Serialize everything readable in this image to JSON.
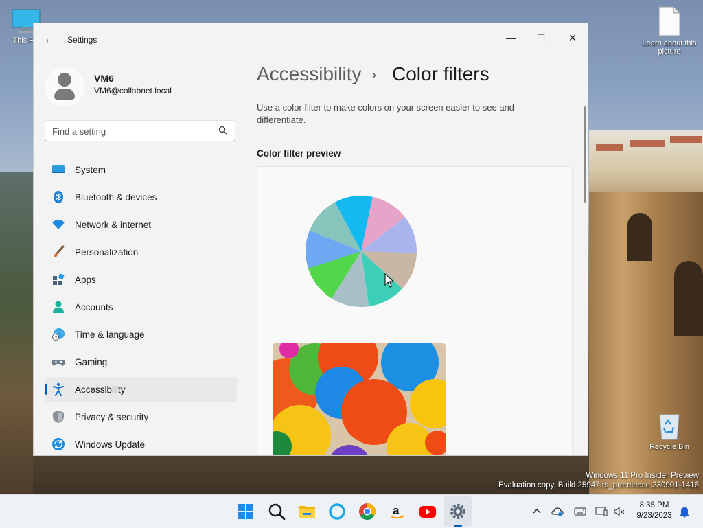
{
  "desktop": {
    "icons": [
      {
        "label": "This PC"
      },
      {
        "label": "Learn about this picture"
      },
      {
        "label": "Recycle Bin"
      }
    ],
    "watermark": {
      "line1": "Windows 11 Pro Insider Preview",
      "line2": "Evaluation copy. Build 25947.rs_prerelease.230901-1416"
    }
  },
  "window": {
    "title": "Settings",
    "controls": {
      "minimize": "—",
      "maximize": "☐",
      "close": "✕"
    }
  },
  "user": {
    "name": "VM6",
    "email": "VM6@collabnet.local"
  },
  "search": {
    "placeholder": "Find a setting"
  },
  "nav": {
    "items": [
      {
        "label": "System",
        "icon": "system-icon"
      },
      {
        "label": "Bluetooth & devices",
        "icon": "bluetooth-icon"
      },
      {
        "label": "Network & internet",
        "icon": "wifi-icon"
      },
      {
        "label": "Personalization",
        "icon": "brush-icon"
      },
      {
        "label": "Apps",
        "icon": "apps-icon"
      },
      {
        "label": "Accounts",
        "icon": "accounts-icon"
      },
      {
        "label": "Time & language",
        "icon": "globe-clock-icon"
      },
      {
        "label": "Gaming",
        "icon": "controller-icon"
      },
      {
        "label": "Accessibility",
        "icon": "accessibility-icon",
        "active": true
      },
      {
        "label": "Privacy & security",
        "icon": "shield-icon"
      },
      {
        "label": "Windows Update",
        "icon": "update-icon"
      }
    ]
  },
  "page": {
    "breadcrumb_parent": "Accessibility",
    "breadcrumb_sep": "›",
    "breadcrumb_current": "Color filters",
    "description": "Use a color filter to make colors on your screen easier to see and differentiate.",
    "section_title": "Color filter preview"
  },
  "preview": {
    "pie_colors": [
      "#e6a4c8",
      "#a9b4ec",
      "#c9b6a4",
      "#3ecfb9",
      "#a8bfc8",
      "#52d74a",
      "#6ea8f3",
      "#87c5bc",
      "#14b9ef"
    ]
  },
  "taskbar": {
    "apps": [
      "windows-start-icon",
      "search-icon",
      "file-explorer-icon",
      "cortana-icon",
      "chrome-icon",
      "amazon-icon",
      "youtube-icon",
      "settings-icon"
    ],
    "clock": {
      "time": "8:35 PM",
      "date": "9/23/2023"
    }
  },
  "colors": {
    "accent": "#005fb8",
    "window_bg": "#f3f3f3",
    "taskbar_bg": "#eef1f6"
  }
}
